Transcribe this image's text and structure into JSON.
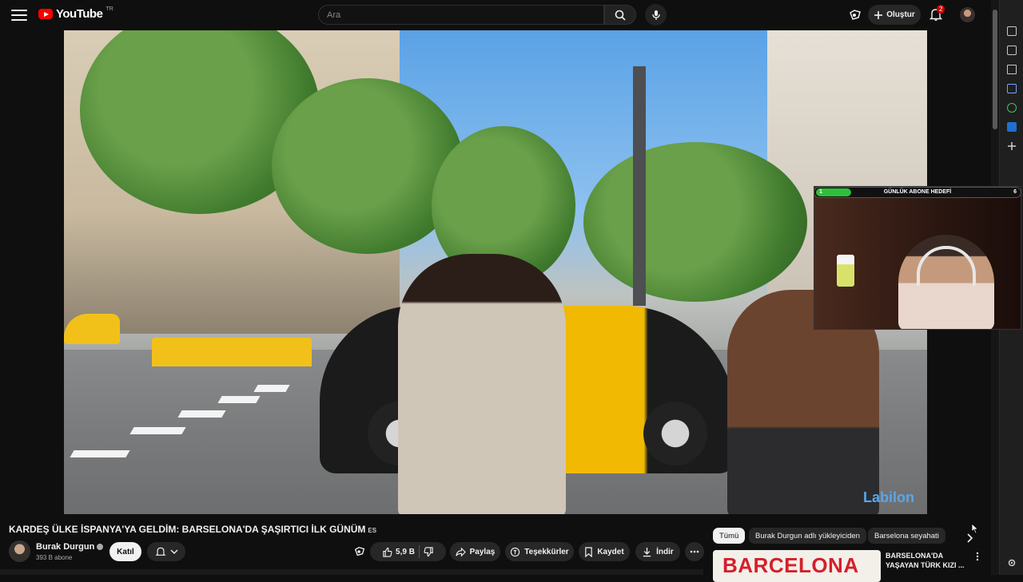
{
  "header": {
    "logo_text": "YouTube",
    "logo_region": "TR",
    "search_placeholder": "Ara",
    "create_label": "Oluştur",
    "notification_count": "2",
    "icons": [
      "menu-icon",
      "search-icon",
      "microphone-icon",
      "cast-icon",
      "plus-icon",
      "bell-icon"
    ]
  },
  "browser_sidebar": {
    "icons": [
      "tab-icon",
      "wallet-icon",
      "clipboard-icon",
      "book-icon",
      "calendar-icon",
      "whatsapp-icon",
      "outlook-icon",
      "add-icon",
      "settings-icon"
    ]
  },
  "overlay": {
    "goal_title": "GÜNLÜK ABONE HEDEFİ",
    "goal_current": "1",
    "goal_target": "6",
    "goal_progress": 0.17,
    "watermark": "Labilon"
  },
  "video": {
    "title": "KARDEŞ ÜLKE İSPANYA'YA GELDİM: BARSELONA'DA ŞAŞIRTICI İLK GÜNÜM",
    "title_suffix": "ES",
    "channel_name": "Burak Durgun",
    "subscribers": "393 B abone",
    "join_label": "Katıl",
    "like_count": "5,9 B",
    "share_label": "Paylaş",
    "thanks_label": "Teşekkürler",
    "save_label": "Kaydet",
    "download_label": "İndir"
  },
  "chips": {
    "all": "Tümü",
    "by_uploader": "Burak Durgun adlı yükleyiciden",
    "barcelona_travel": "Barselona seyahati"
  },
  "recommendation": {
    "thumb_text": "BARCELONA",
    "title": "BARSELONA'DA YAŞAYAN TÜRK KIZI ..."
  },
  "colors": {
    "background": "#0f0f0f",
    "brand_red": "#ff0000",
    "badge_red": "#cc0000",
    "goal_green": "#2fbf3a"
  }
}
